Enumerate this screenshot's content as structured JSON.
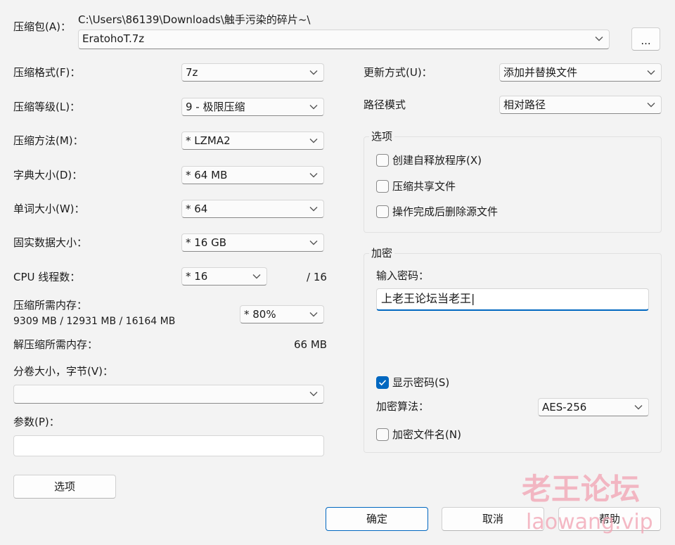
{
  "archive": {
    "label": "压缩包(A)：",
    "path": "C:\\Users\\86139\\Downloads\\触手污染的碎片~\\",
    "filename": "EratohoT.7z",
    "browse_label": "..."
  },
  "left": {
    "format": {
      "label": "压缩格式(F)：",
      "value": "7z"
    },
    "level": {
      "label": "压缩等级(L)：",
      "value": "9 - 极限压缩"
    },
    "method": {
      "label": "压缩方法(M)：",
      "value": "* LZMA2"
    },
    "dict": {
      "label": "字典大小(D)：",
      "value": "* 64 MB"
    },
    "word": {
      "label": "单词大小(W)：",
      "value": "* 64"
    },
    "solid": {
      "label": "固实数据大小：",
      "value": "* 16 GB"
    },
    "cpu": {
      "label": "CPU 线程数：",
      "value": "* 16",
      "max": "/ 16"
    },
    "mem_compress": {
      "label": "压缩所需内存：",
      "detail": "9309 MB / 12931 MB / 16164 MB",
      "value": "* 80%"
    },
    "mem_decompress": {
      "label": "解压缩所需内存：",
      "value": "66 MB"
    },
    "volume": {
      "label": "分卷大小，字节(V)：",
      "value": ""
    },
    "params": {
      "label": "参数(P)：",
      "value": ""
    },
    "options_button": "选项"
  },
  "right": {
    "update": {
      "label": "更新方式(U)：",
      "value": "添加并替换文件"
    },
    "path_mode": {
      "label": "路径模式",
      "value": "相对路径"
    },
    "options": {
      "title": "选项",
      "items": [
        {
          "label": "创建自释放程序(X)",
          "checked": false
        },
        {
          "label": "压缩共享文件",
          "checked": false
        },
        {
          "label": "操作完成后删除源文件",
          "checked": false
        }
      ]
    },
    "encryption": {
      "title": "加密",
      "password_label": "输入密码：",
      "password_value": "上老王论坛当老王|",
      "show_password": "显示密码(S)",
      "show_password_checked": true,
      "method_label": "加密算法：",
      "method_value": "AES-256",
      "encrypt_names": "加密文件名(N)",
      "encrypt_names_checked": false
    }
  },
  "footer": {
    "ok": "确定",
    "cancel": "取消",
    "help": "帮助"
  },
  "watermark": {
    "line1": "老王论坛",
    "line2": "laowang.vip",
    "color": "#f2a8b6"
  },
  "colors": {
    "accent": "#0067c0",
    "background": "#f3f3f3"
  },
  "icons": {
    "dropdown": "chevron-down-icon",
    "check": "check-icon"
  }
}
